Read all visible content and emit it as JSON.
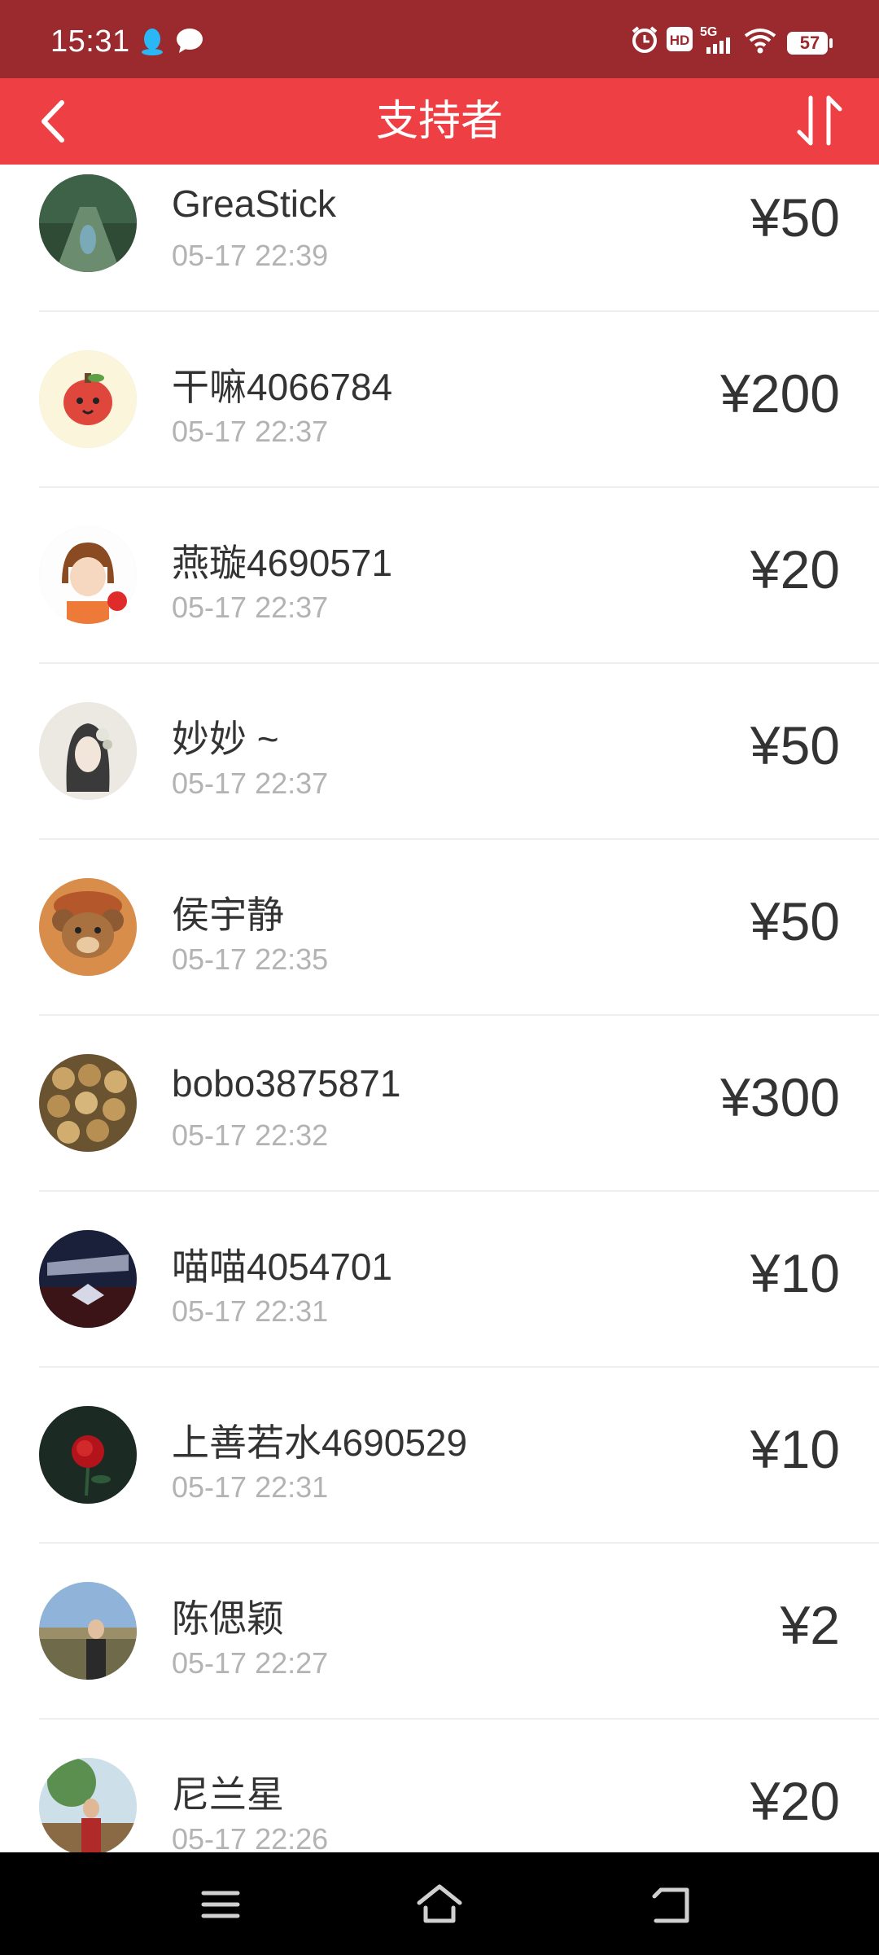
{
  "status_bar": {
    "time": "15:31",
    "battery": "57",
    "network": "5G",
    "hd": "HD"
  },
  "header": {
    "title": "支持者"
  },
  "supporters": [
    {
      "name": "GreaStick",
      "time": "05-17 22:39",
      "amount": "¥50"
    },
    {
      "name": "干嘛4066784",
      "time": "05-17 22:37",
      "amount": "¥200"
    },
    {
      "name": "燕璇4690571",
      "time": "05-17 22:37",
      "amount": "¥20"
    },
    {
      "name": "妙妙 ~",
      "time": "05-17 22:37",
      "amount": "¥50"
    },
    {
      "name": "侯宇静",
      "time": "05-17 22:35",
      "amount": "¥50"
    },
    {
      "name": "bobo3875871",
      "time": "05-17 22:32",
      "amount": "¥300"
    },
    {
      "name": "喵喵4054701",
      "time": "05-17 22:31",
      "amount": "¥10"
    },
    {
      "name": "上善若水4690529",
      "time": "05-17 22:31",
      "amount": "¥10"
    },
    {
      "name": "陈偲颖",
      "time": "05-17 22:27",
      "amount": "¥2"
    },
    {
      "name": "尼兰星",
      "time": "05-17 22:26",
      "amount": "¥20"
    }
  ],
  "colors": {
    "status_bar": "#9b2a2e",
    "title_bar": "#ee3f45",
    "name_text": "#333333",
    "time_text": "#b3b3b3",
    "divider": "#eeeeee"
  },
  "icons": {
    "back": "chevron-left-icon",
    "sort": "sort-arrows-icon",
    "nav_menu": "menu-icon",
    "nav_home": "home-icon",
    "nav_back": "back-icon"
  }
}
